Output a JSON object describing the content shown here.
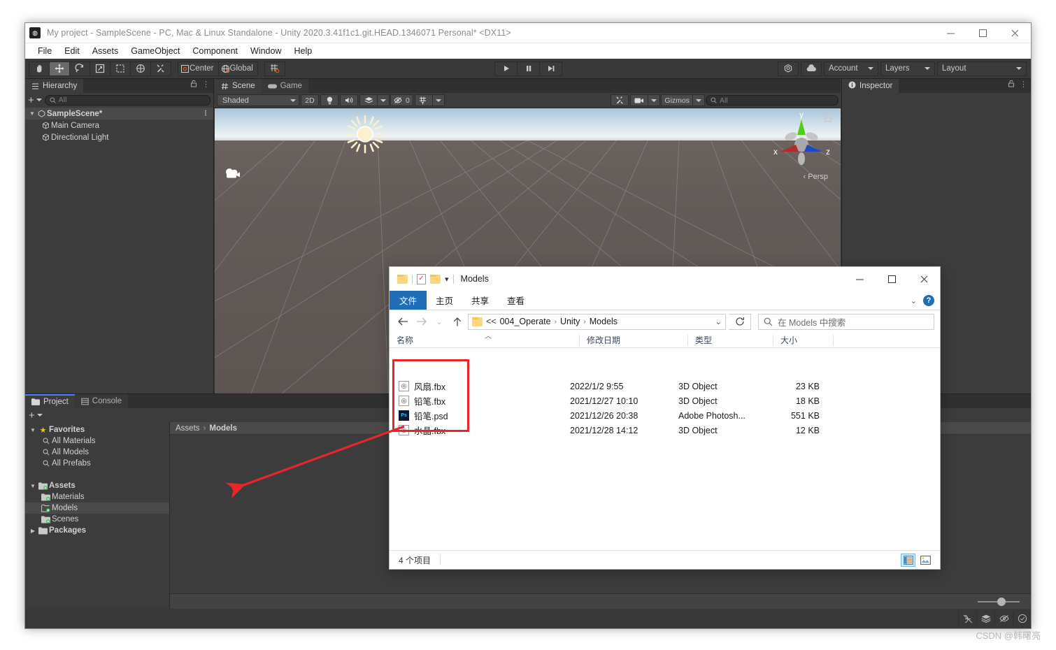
{
  "unity": {
    "title": "My project - SampleScene - PC, Mac & Linux Standalone - Unity 2020.3.41f1c1.git.HEAD.1346071 Personal* <DX11>",
    "menu": [
      "File",
      "Edit",
      "Assets",
      "GameObject",
      "Component",
      "Window",
      "Help"
    ],
    "toolbar": {
      "tools": [
        "hand-tool",
        "move-tool",
        "rotate-tool",
        "scale-tool",
        "rect-tool",
        "transform-tool",
        "custom-tool"
      ],
      "pivot_label": "Center",
      "handle_label": "Global",
      "snap_label": "grid-snap",
      "play_label": "play",
      "pause_label": "pause",
      "step_label": "step",
      "collab_label": "collab",
      "cloud_label": "cloud",
      "account_label": "Account",
      "layers_label": "Layers",
      "layout_label": "Layout"
    },
    "hierarchy": {
      "tab": "Hierarchy",
      "search_placeholder": "All",
      "items": [
        {
          "label": "SampleScene*",
          "depth": 0,
          "selected": true
        },
        {
          "label": "Main Camera",
          "depth": 1,
          "selected": false
        },
        {
          "label": "Directional Light",
          "depth": 1,
          "selected": false
        }
      ]
    },
    "sceneview": {
      "tabs": [
        "Scene",
        "Game"
      ],
      "active_tab": "Scene",
      "draw_mode": "Shaded",
      "mode_2d": "2D",
      "hidden_count": "0",
      "gizmos_label": "Gizmos",
      "search_placeholder": "All",
      "axis_labels": {
        "x": "x",
        "y": "y",
        "z": "z"
      },
      "projection": "Persp"
    },
    "inspector": {
      "tab": "Inspector"
    },
    "project": {
      "tabs": [
        "Project",
        "Console"
      ],
      "active_tab": "Project",
      "tree": [
        {
          "label": "Favorites",
          "depth": 0,
          "icon": "star-icon",
          "bold": true,
          "twisty": "▼",
          "selected": false
        },
        {
          "label": "All Materials",
          "depth": 1,
          "icon": "search-icon",
          "bold": false,
          "twisty": "",
          "selected": false
        },
        {
          "label": "All Models",
          "depth": 1,
          "icon": "search-icon",
          "bold": false,
          "twisty": "",
          "selected": false
        },
        {
          "label": "All Prefabs",
          "depth": 1,
          "icon": "search-icon",
          "bold": false,
          "twisty": "",
          "selected": false
        },
        {
          "label": "",
          "depth": 0,
          "icon": "",
          "bold": false,
          "twisty": "",
          "selected": false
        },
        {
          "label": "Assets",
          "depth": 0,
          "icon": "folder-icon",
          "bold": true,
          "twisty": "▼",
          "selected": false
        },
        {
          "label": "Materials",
          "depth": 1,
          "icon": "folder-icon",
          "bold": false,
          "twisty": "",
          "selected": false
        },
        {
          "label": "Models",
          "depth": 1,
          "icon": "folder-open-icon",
          "bold": false,
          "twisty": "",
          "selected": true
        },
        {
          "label": "Scenes",
          "depth": 1,
          "icon": "folder-icon",
          "bold": false,
          "twisty": "",
          "selected": false
        },
        {
          "label": "Packages",
          "depth": 0,
          "icon": "folder-icon",
          "bold": true,
          "twisty": "▶",
          "selected": false
        }
      ],
      "breadcrumb": [
        "Assets",
        "Models"
      ]
    }
  },
  "explorer": {
    "title": "Models",
    "quick_access": [
      "folder-icon",
      "properties-icon",
      "new-folder-icon",
      "customize-chevron-icon"
    ],
    "ribbon_tabs": [
      "文件",
      "主页",
      "共享",
      "查看"
    ],
    "ribbon_active": "文件",
    "nav": {
      "back": "back-arrow-icon",
      "forward": "forward-arrow-icon",
      "recent": "recent-chevron-icon",
      "up": "up-arrow-icon",
      "breadcrumb": [
        "<<",
        "004_Operate",
        "Unity",
        "Models"
      ],
      "refresh": "refresh-icon",
      "search_placeholder": "在 Models 中搜索"
    },
    "columns": [
      "名称",
      "修改日期",
      "类型",
      "大小"
    ],
    "files": [
      {
        "name": "风扇.fbx",
        "icon": "fbx-icon",
        "date": "2022/1/2 9:55",
        "type": "3D Object",
        "size": "23 KB"
      },
      {
        "name": "铅笔.fbx",
        "icon": "fbx-icon",
        "date": "2021/12/27 10:10",
        "type": "3D Object",
        "size": "18 KB"
      },
      {
        "name": "铅笔.psd",
        "icon": "psd-icon",
        "date": "2021/12/26 20:38",
        "type": "Adobe Photosh...",
        "size": "551 KB"
      },
      {
        "name": "水晶.fbx",
        "icon": "fbx-icon",
        "date": "2021/12/28 14:12",
        "type": "3D Object",
        "size": "12 KB"
      }
    ],
    "status_count": "4 个项目",
    "view_buttons": [
      "details-view-icon",
      "large-icons-view-icon"
    ]
  },
  "annotation": {
    "color": "#e8262a",
    "box_label": "file-selection-highlight",
    "arrow_label": "drag-to-project-arrow"
  },
  "watermark": "CSDN @韩曙亮"
}
